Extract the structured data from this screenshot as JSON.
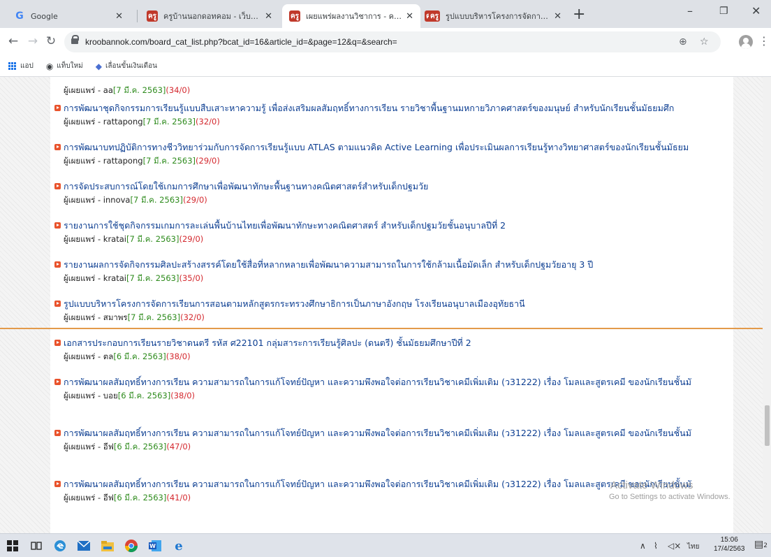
{
  "browser": {
    "tabs": [
      {
        "title": "Google",
        "favicon": "google-icon",
        "active": false
      },
      {
        "title": "ครูบ้านนอกดอทคอม - เว็บไซต์เพื่อครู",
        "favicon": "site-icon",
        "active": false
      },
      {
        "title": "เผยแพร่ผลงานวิชาการ - ครูบ้านนอก",
        "favicon": "site-icon",
        "active": true
      },
      {
        "title": "รูปแบบบริหารโครงการจัดการเรียนการส",
        "favicon": "site-icon",
        "active": false
      }
    ],
    "new_tab_label": "+",
    "url_text": "kroobannok.com/board_cat_list.php?bcat_id=16&article_id=&page=12&q=&search=",
    "bookmarks": [
      {
        "label": "แอป",
        "icon": "apps-grid-icon"
      },
      {
        "label": "แท็บใหม่",
        "icon": "globe-icon"
      },
      {
        "label": "เลื่อนขั้นเงินเดือน",
        "icon": "bookmark-icon"
      }
    ]
  },
  "list": {
    "meta_label": "ผู้เผยแพร่",
    "items": [
      {
        "title": "",
        "user": "aa",
        "date": "7 มี.ค. 2563",
        "counts": "(34/0)"
      },
      {
        "title": "การพัฒนาชุดกิจกรรมการเรียนรู้แบบสืบเสาะหาความรู้ เพื่อส่งเสริมผลสัมฤทธิ์ทางการเรียน รายวิชาพื้นฐานมหกายวิภาคศาสตร์ของมนุษย์ สำหรับนักเรียนชั้นมัธยมศึก",
        "user": "rattapong",
        "date": "7 มี.ค. 2563",
        "counts": "(32/0)"
      },
      {
        "title": "การพัฒนาบทปฏิบัติการทางชีววิทยาร่วมกับการจัดการเรียนรู้แบบ ATLAS ตามแนวคิด Active Learning เพื่อประเมินผลการเรียนรู้ทางวิทยาศาสตร์ของนักเรียนชั้นมัธยม",
        "user": "rattapong",
        "date": "7 มี.ค. 2563",
        "counts": "(29/0)"
      },
      {
        "title": "การจัดประสบการณ์โดยใช้เกมการศึกษาเพื่อพัฒนาทักษะพื้นฐานทางคณิตศาสตร์สำหรับเด็กปฐมวัย",
        "user": "innova",
        "date": "7 มี.ค. 2563",
        "counts": "(29/0)"
      },
      {
        "title": "รายงานการใช้ชุดกิจกรรมเกมการละเล่นพื้นบ้านไทยเพื่อพัฒนาทักษะทางคณิตศาสตร์ สำหรับเด็กปฐมวัยชั้นอนุบาลปีที่ 2",
        "user": "kratai",
        "date": "7 มี.ค. 2563",
        "counts": "(29/0)"
      },
      {
        "title": "รายงานผลการจัดกิจกรรมศิลปะสร้างสรรค์โดยใช้สื่อที่หลากหลายเพื่อพัฒนาความสามารถในการใช้กล้ามเนื้อมัดเล็ก สำหรับเด็กปฐมวัยอายุ 3 ปี",
        "user": "kratai",
        "date": "7 มี.ค. 2563",
        "counts": "(35/0)"
      },
      {
        "title": "รูปแบบบริหารโครงการจัดการเรียนการสอนตามหลักสูตรกระทรวงศึกษาธิการเป็นภาษาอังกฤษ โรงเรียนอนุบาลเมืองอุทัยธานี",
        "user": "สมาพร",
        "date": "7 มี.ค. 2563",
        "counts": "(32/0)"
      },
      {
        "title": "เอกสารประกอบการเรียนรายวิชาดนตรี รหัส ศ22101 กลุ่มสาระการเรียนรู้ศิลปะ (ดนตรี) ชั้นมัธยมศึกษาปีที่ 2",
        "user": "ตล",
        "date": "6 มี.ค. 2563",
        "counts": "(38/0)"
      },
      {
        "title": "การพัฒนาผลสัมฤทธิ์ทางการเรียน ความสามารถในการแก้โจทย์ปัญหา และความพึงพอใจต่อการเรียนวิชาเคมีเพิ่มเติม (ว31222) เรื่อง โมลและสูตรเคมี ของนักเรียนชั้นมั",
        "user": "บอย",
        "date": "6 มี.ค. 2563",
        "counts": "(38/0)"
      },
      {
        "title": "การพัฒนาผลสัมฤทธิ์ทางการเรียน ความสามารถในการแก้โจทย์ปัญหา และความพึงพอใจต่อการเรียนวิชาเคมีเพิ่มเติม (ว31222) เรื่อง โมลและสูตรเคมี ของนักเรียนชั้นมั",
        "user": "อีฟ",
        "date": "6 มี.ค. 2563",
        "counts": "(47/0)"
      },
      {
        "title": "การพัฒนาผลสัมฤทธิ์ทางการเรียน ความสามารถในการแก้โจทย์ปัญหา และความพึงพอใจต่อการเรียนวิชาเคมีเพิ่มเติม (ว31222) เรื่อง โมลและสูตรเคมี ของนักเรียนชั้นมั",
        "user": "อีฟ",
        "date": "6 มี.ค. 2563",
        "counts": "(41/0)"
      }
    ]
  },
  "watermark": {
    "title": "Activate Windows",
    "subtitle": "Go to Settings to activate Windows."
  },
  "taskbar": {
    "apps": [
      "windows-start-icon",
      "task-view-icon",
      "edge-icon",
      "mail-icon",
      "file-explorer-icon",
      "chrome-icon",
      "word-icon",
      "ie-icon"
    ],
    "ime": "ไทย",
    "time": "15:06",
    "date": "17/4/2563",
    "notification_count": "2"
  },
  "colors": {
    "link": "#0b3d91",
    "date": "#2e8b1d",
    "count": "#d4292f",
    "bullet": "#e9532c",
    "divider": "#e39a4a"
  }
}
